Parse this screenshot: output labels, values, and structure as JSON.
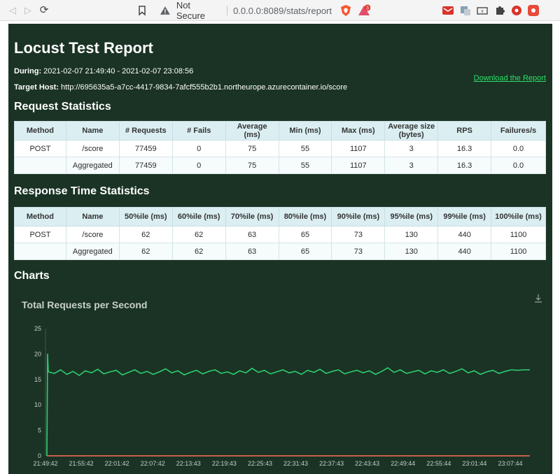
{
  "browser": {
    "security_label": "Not Secure",
    "url": "0.0.0.0:8089/stats/report",
    "brave_badge": "",
    "extension_badge": "3"
  },
  "report": {
    "title": "Locust Test Report",
    "during_label": "During:",
    "during_value": "2021-02-07 21:49:40 - 2021-02-07 23:08:56",
    "host_label": "Target Host:",
    "host_value": "http://695635a5-a7cc-4417-9834-7afcf555b2b1.northeurope.azurecontainer.io/score",
    "download_label": "Download the Report"
  },
  "request_stats": {
    "heading": "Request Statistics",
    "columns": [
      "Method",
      "Name",
      "# Requests",
      "# Fails",
      "Average (ms)",
      "Min (ms)",
      "Max (ms)",
      "Average size (bytes)",
      "RPS",
      "Failures/s"
    ],
    "rows": [
      [
        "POST",
        "/score",
        "77459",
        "0",
        "75",
        "55",
        "1107",
        "3",
        "16.3",
        "0.0"
      ],
      [
        "",
        "Aggregated",
        "77459",
        "0",
        "75",
        "55",
        "1107",
        "3",
        "16.3",
        "0.0"
      ]
    ]
  },
  "response_stats": {
    "heading": "Response Time Statistics",
    "columns": [
      "Method",
      "Name",
      "50%ile (ms)",
      "60%ile (ms)",
      "70%ile (ms)",
      "80%ile (ms)",
      "90%ile (ms)",
      "95%ile (ms)",
      "99%ile (ms)",
      "100%ile (ms)"
    ],
    "rows": [
      [
        "POST",
        "/score",
        "62",
        "62",
        "63",
        "65",
        "73",
        "130",
        "440",
        "1100"
      ],
      [
        "",
        "Aggregated",
        "62",
        "62",
        "63",
        "65",
        "73",
        "130",
        "440",
        "1100"
      ]
    ]
  },
  "charts": {
    "heading": "Charts"
  },
  "chart_data": {
    "type": "line",
    "title": "Total Requests per Second",
    "xlabel": "",
    "ylabel": "",
    "ylim": [
      0,
      25
    ],
    "yticks": [
      0,
      5,
      10,
      15,
      20,
      25
    ],
    "x_tick_labels": [
      "21:49:42",
      "21:55:42",
      "22:01:42",
      "22:07:42",
      "22:13:43",
      "22:19:43",
      "22:25:43",
      "22:31:43",
      "22:37:43",
      "22:43:43",
      "22:49:44",
      "22:55:44",
      "23:01:44",
      "23:07:44"
    ],
    "series": [
      {
        "color": "#2ecc71",
        "values": [
          0,
          20,
          16.5,
          16.2,
          16.9,
          16.0,
          16.6,
          15.8,
          16.7,
          16.3,
          17.0,
          16.1,
          16.5,
          16.8,
          15.9,
          16.4,
          16.9,
          16.2,
          16.6,
          16.0,
          16.5,
          17.1,
          16.3,
          16.7,
          15.9,
          16.4,
          16.8,
          16.1,
          16.6,
          16.9,
          16.2,
          16.5,
          16.0,
          16.7,
          16.3,
          17.2,
          16.4,
          16.8,
          16.1,
          16.5,
          16.9,
          16.3,
          16.6,
          16.0,
          16.8,
          16.4,
          17.0,
          16.2,
          16.6,
          16.9,
          16.1,
          16.5,
          16.8,
          16.3,
          16.7,
          16.0,
          16.6,
          17.3,
          16.4,
          16.9,
          16.2,
          16.5,
          16.8,
          16.1,
          16.7,
          16.4,
          16.9,
          16.2,
          16.6,
          17.1,
          16.3,
          16.7,
          16.0,
          16.5,
          16.8,
          16.2,
          16.6,
          16.9,
          16.8,
          16.9,
          16.9
        ]
      },
      {
        "color": "#ff6d57",
        "values": [
          0,
          0,
          0,
          0,
          0,
          0,
          0,
          0,
          0,
          0,
          0,
          0,
          0,
          0,
          0,
          0,
          0,
          0,
          0,
          0,
          0,
          0,
          0,
          0,
          0,
          0,
          0,
          0,
          0,
          0,
          0,
          0,
          0,
          0,
          0,
          0,
          0,
          0,
          0,
          0,
          0,
          0,
          0,
          0,
          0,
          0,
          0,
          0,
          0,
          0,
          0,
          0,
          0,
          0,
          0,
          0,
          0,
          0,
          0,
          0,
          0,
          0,
          0,
          0,
          0,
          0,
          0,
          0,
          0,
          0,
          0,
          0,
          0,
          0,
          0,
          0,
          0,
          0,
          0,
          0,
          0
        ]
      }
    ],
    "grid": false
  }
}
